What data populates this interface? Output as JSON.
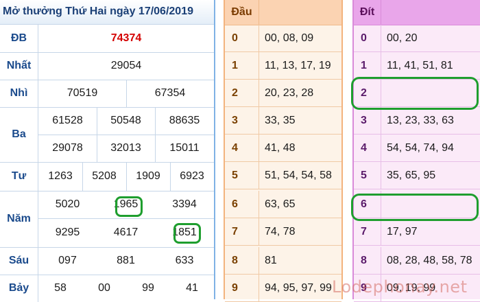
{
  "header": {
    "title": "Mở thưởng Thứ Hai ngày 17/06/2019"
  },
  "prizes": {
    "db": {
      "label": "ĐB",
      "values": [
        "74374"
      ]
    },
    "nhat": {
      "label": "Nhất",
      "values": [
        "29054"
      ]
    },
    "nhi": {
      "label": "Nhì",
      "values": [
        "70519",
        "67354"
      ]
    },
    "ba": {
      "label": "Ba",
      "values": [
        "61528",
        "50548",
        "88635",
        "29078",
        "32013",
        "15011"
      ]
    },
    "tu": {
      "label": "Tư",
      "values": [
        "1263",
        "5208",
        "1909",
        "6923"
      ]
    },
    "nam": {
      "label": "Năm",
      "values": [
        "5020",
        "1965",
        "3394",
        "9295",
        "4617",
        "1851"
      ]
    },
    "sau": {
      "label": "Sáu",
      "values": [
        "097",
        "881",
        "633"
      ]
    },
    "bay": {
      "label": "Bảy",
      "values": [
        "58",
        "00",
        "99",
        "41"
      ]
    }
  },
  "dau": {
    "header": "Đầu",
    "rows": [
      {
        "num": "0",
        "vals": "00, 08, 09"
      },
      {
        "num": "1",
        "vals": "11, 13, 17, 19"
      },
      {
        "num": "2",
        "vals": "20, 23, 28"
      },
      {
        "num": "3",
        "vals": "33, 35"
      },
      {
        "num": "4",
        "vals": "41, 48"
      },
      {
        "num": "5",
        "vals": "51, 54, 54, 58"
      },
      {
        "num": "6",
        "vals": "63, 65"
      },
      {
        "num": "7",
        "vals": "74, 78"
      },
      {
        "num": "8",
        "vals": "81"
      },
      {
        "num": "9",
        "vals": "94, 95, 97, 99"
      }
    ]
  },
  "dit": {
    "header": "Đít",
    "rows": [
      {
        "num": "0",
        "vals": "00, 20"
      },
      {
        "num": "1",
        "vals": "11, 41, 51, 81"
      },
      {
        "num": "2",
        "vals": ""
      },
      {
        "num": "3",
        "vals": "13, 23, 33, 63"
      },
      {
        "num": "4",
        "vals": "54, 54, 74, 94"
      },
      {
        "num": "5",
        "vals": "35, 65, 95"
      },
      {
        "num": "6",
        "vals": ""
      },
      {
        "num": "7",
        "vals": "17, 97"
      },
      {
        "num": "8",
        "vals": "08, 28, 48, 58, 78"
      },
      {
        "num": "9",
        "vals": "09, 19, 99"
      }
    ]
  },
  "watermark": "Lodephonay.net",
  "colors": {
    "db_value": "#d40000",
    "label": "#1a4a8c",
    "highlight": "#1e9e2e",
    "dau_header": "#fbd3b2",
    "dit_header": "#e9a6ea"
  }
}
